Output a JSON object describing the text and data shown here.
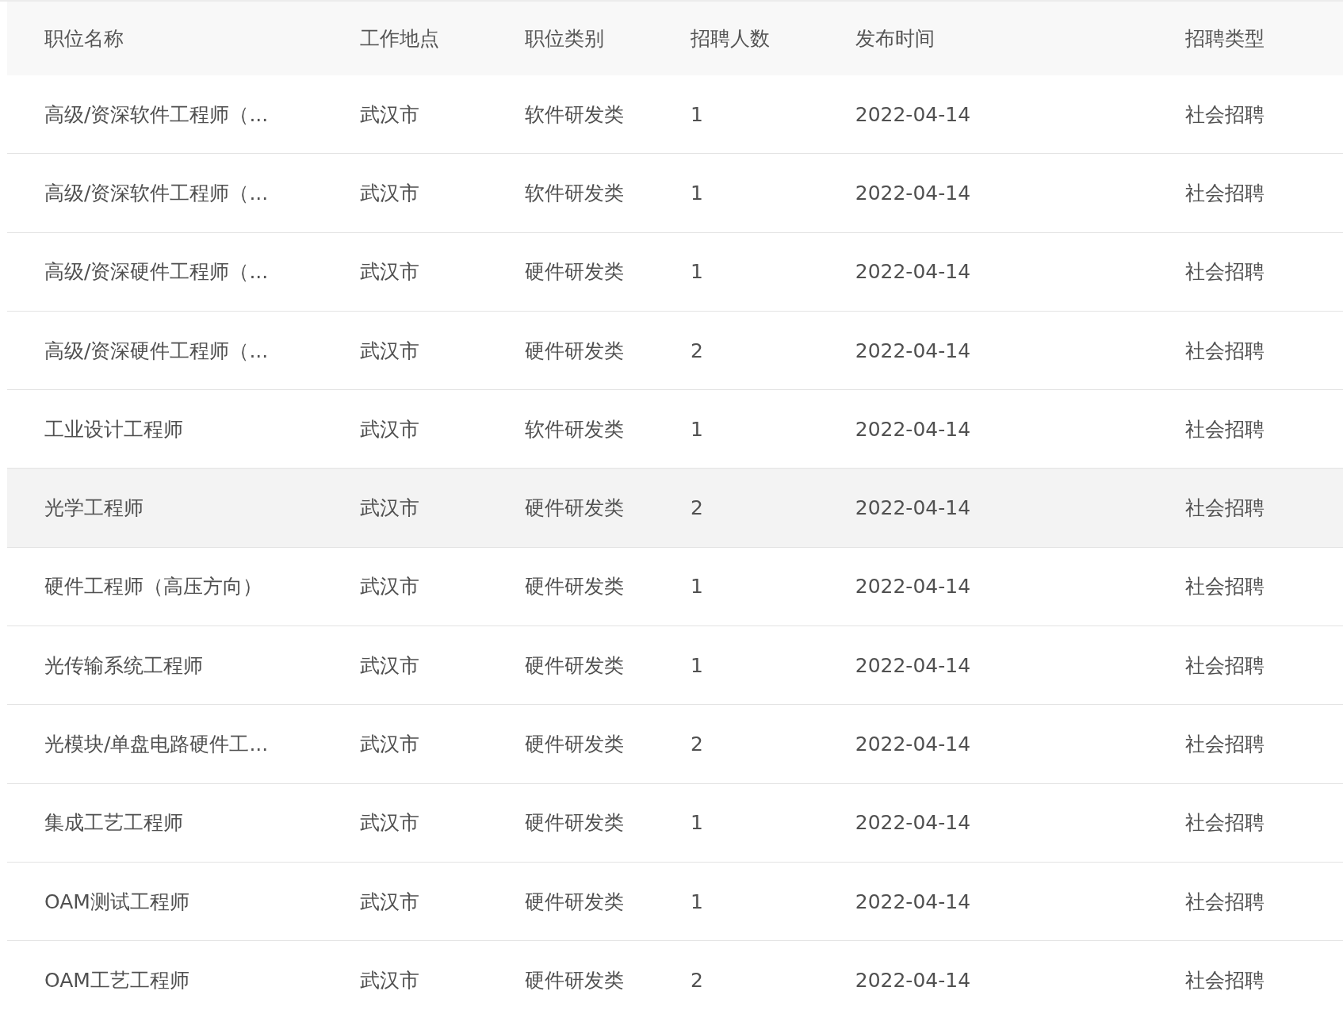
{
  "table": {
    "columns": [
      "职位名称",
      "工作地点",
      "职位类别",
      "招聘人数",
      "发布时间",
      "招聘类型"
    ],
    "rows": [
      {
        "cells": [
          "高级/资深软件工程师（...",
          "武汉市",
          "软件研发类",
          "1",
          "2022-04-14",
          "社会招聘"
        ],
        "highlighted": false
      },
      {
        "cells": [
          "高级/资深软件工程师（...",
          "武汉市",
          "软件研发类",
          "1",
          "2022-04-14",
          "社会招聘"
        ],
        "highlighted": false
      },
      {
        "cells": [
          "高级/资深硬件工程师（...",
          "武汉市",
          "硬件研发类",
          "1",
          "2022-04-14",
          "社会招聘"
        ],
        "highlighted": false
      },
      {
        "cells": [
          "高级/资深硬件工程师（...",
          "武汉市",
          "硬件研发类",
          "2",
          "2022-04-14",
          "社会招聘"
        ],
        "highlighted": false
      },
      {
        "cells": [
          "工业设计工程师",
          "武汉市",
          "软件研发类",
          "1",
          "2022-04-14",
          "社会招聘"
        ],
        "highlighted": false
      },
      {
        "cells": [
          "光学工程师",
          "武汉市",
          "硬件研发类",
          "2",
          "2022-04-14",
          "社会招聘"
        ],
        "highlighted": true
      },
      {
        "cells": [
          "硬件工程师（高压方向）",
          "武汉市",
          "硬件研发类",
          "1",
          "2022-04-14",
          "社会招聘"
        ],
        "highlighted": false
      },
      {
        "cells": [
          "光传输系统工程师",
          "武汉市",
          "硬件研发类",
          "1",
          "2022-04-14",
          "社会招聘"
        ],
        "highlighted": false
      },
      {
        "cells": [
          "光模块/单盘电路硬件工...",
          "武汉市",
          "硬件研发类",
          "2",
          "2022-04-14",
          "社会招聘"
        ],
        "highlighted": false
      },
      {
        "cells": [
          "集成工艺工程师",
          "武汉市",
          "硬件研发类",
          "1",
          "2022-04-14",
          "社会招聘"
        ],
        "highlighted": false
      },
      {
        "cells": [
          "OAM测试工程师",
          "武汉市",
          "硬件研发类",
          "1",
          "2022-04-14",
          "社会招聘"
        ],
        "highlighted": false
      },
      {
        "cells": [
          "OAM工艺工程师",
          "武汉市",
          "硬件研发类",
          "2",
          "2022-04-14",
          "社会招聘"
        ],
        "highlighted": false
      }
    ]
  }
}
